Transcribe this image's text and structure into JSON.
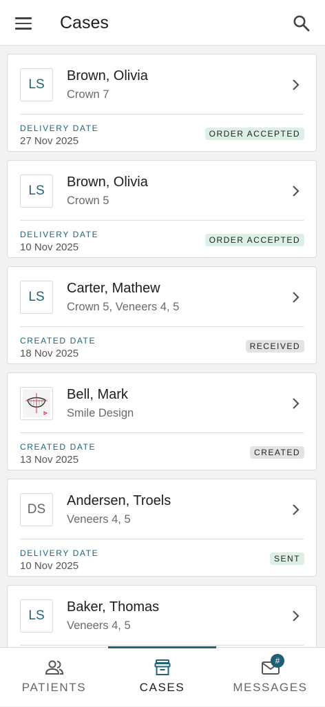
{
  "app": {
    "title": "Cases"
  },
  "cases": [
    {
      "initials": "LS",
      "name": "Brown, Olivia",
      "subtitle": "Crown 7",
      "date_label": "DELIVERY DATE",
      "date": "27 Nov 2025",
      "status": "ORDER ACCEPTED",
      "status_color": "#ddf0e5"
    },
    {
      "initials": "LS",
      "name": "Brown, Olivia",
      "subtitle": "Crown 5",
      "date_label": "DELIVERY DATE",
      "date": "10 Nov 2025",
      "status": "ORDER ACCEPTED",
      "status_color": "#ddf0e5"
    },
    {
      "initials": "LS",
      "name": "Carter, Mathew",
      "subtitle": "Crown 5, Veneers 4, 5",
      "date_label": "CREATED DATE",
      "date": "18 Nov 2025",
      "status": "RECEIVED",
      "status_color": "#e3e3e3"
    },
    {
      "initials": "",
      "avatar_icon": "smile-design-icon",
      "name": "Bell, Mark",
      "subtitle": "Smile Design",
      "date_label": "CREATED DATE",
      "date": "13 Nov 2025",
      "status": "CREATED",
      "status_color": "#e3e3e3"
    },
    {
      "initials": "DS",
      "name": "Andersen, Troels",
      "subtitle": "Veneers 4, 5",
      "date_label": "DELIVERY DATE",
      "date": "10 Nov 2025",
      "status": "SENT",
      "status_color": "#ddf0e5"
    },
    {
      "initials": "LS",
      "name": "Baker, Thomas",
      "subtitle": "Veneers 4, 5"
    }
  ],
  "nav": {
    "patients": "PATIENTS",
    "cases": "CASES",
    "messages": "MESSAGES",
    "messages_badge": "#"
  },
  "colors": {
    "accent": "#1f6478",
    "status_green": "#ddf0e5",
    "status_gray": "#e3e3e3"
  }
}
